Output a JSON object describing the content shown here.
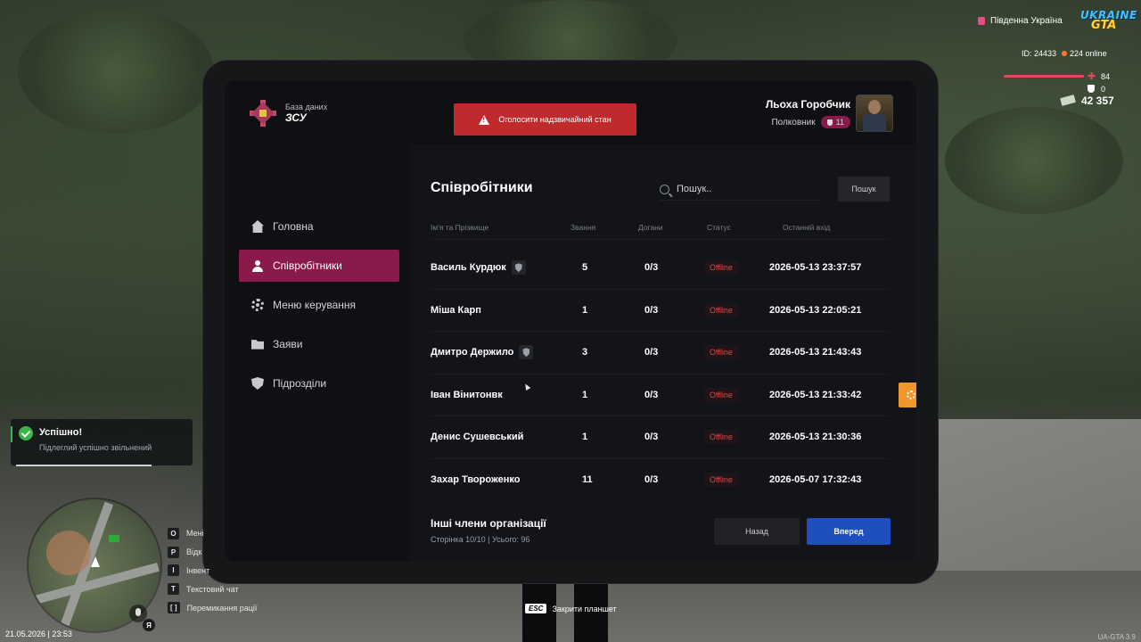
{
  "hud": {
    "region": "Південна Україна",
    "logo_line1": "UKRAINE",
    "logo_line2": "GTA",
    "id_text": "ID: 24433",
    "online_text": "224 online",
    "health": "84",
    "armor": "0",
    "money": "42 357",
    "datetime": "21.05.2026 | 23:53",
    "version": "UA-GTA 3.9",
    "esc_key": "ESC",
    "esc_label": "Закрити планшет",
    "lang": "Я"
  },
  "notification": {
    "title": "Успішно!",
    "text": "Підлеглий успішно звільнений"
  },
  "hotkeys": [
    {
      "key": "O",
      "label": "Мені"
    },
    {
      "key": "P",
      "label": "Відк"
    },
    {
      "key": "I",
      "label": "Інвент"
    },
    {
      "key": "T",
      "label": "Текстовий чат"
    },
    {
      "key": "[ ]",
      "label": "Перемикання рації"
    }
  ],
  "tablet": {
    "brand_subtitle": "База даних",
    "brand_title": "ЗСУ",
    "alert_button": "Оголосити надзвичайний стан",
    "user": {
      "name": "Льоха Горобчик",
      "rank": "Полковник",
      "level": "11"
    },
    "nav": [
      {
        "label": "Головна",
        "icon": "home-icon"
      },
      {
        "label": "Співробітники",
        "icon": "people-icon",
        "active": true
      },
      {
        "label": "Меню керування",
        "icon": "gear-icon"
      },
      {
        "label": "Заяви",
        "icon": "folder-icon"
      },
      {
        "label": "Підрозділи",
        "icon": "shield-icon"
      }
    ],
    "page_title": "Співробітники",
    "search": {
      "placeholder": "Пошук..",
      "button": "Пошук"
    },
    "columns": [
      "Ім'я та Прізвище",
      "Звання",
      "Догани",
      "Статус",
      "Останній вхід"
    ],
    "rows": [
      {
        "name": "Василь Курдюк",
        "leader": true,
        "rank": "5",
        "warnings": "0/3",
        "status": "Offline",
        "last": "2026-05-13 23:37:57"
      },
      {
        "name": "Міша Карп",
        "leader": false,
        "rank": "1",
        "warnings": "0/3",
        "status": "Offline",
        "last": "2026-05-13 22:05:21"
      },
      {
        "name": "Дмитро Держило",
        "leader": true,
        "rank": "3",
        "warnings": "0/3",
        "status": "Offline",
        "last": "2026-05-13 21:43:43"
      },
      {
        "name": "Іван Вінитонвк",
        "leader": false,
        "rank": "1",
        "warnings": "0/3",
        "status": "Offline",
        "last": "2026-05-13 21:33:42"
      },
      {
        "name": "Денис Сушевський",
        "leader": false,
        "rank": "1",
        "warnings": "0/3",
        "status": "Offline",
        "last": "2026-05-13 21:30:36"
      },
      {
        "name": "Захар Твороженко",
        "leader": false,
        "rank": "11",
        "warnings": "0/3",
        "status": "Offline",
        "last": "2026-05-07 17:32:43"
      }
    ],
    "footer": {
      "heading": "Інші члени організації",
      "pagination": "Сторінка 10/10 | Усього: 96",
      "back": "Назад",
      "next": "Вперед"
    }
  },
  "colors": {
    "accent": "#8a1a4c",
    "alert": "#c12a2d",
    "primary_button": "#1f4fbf",
    "action": "#f0962e",
    "offline": "#e04a4a"
  }
}
